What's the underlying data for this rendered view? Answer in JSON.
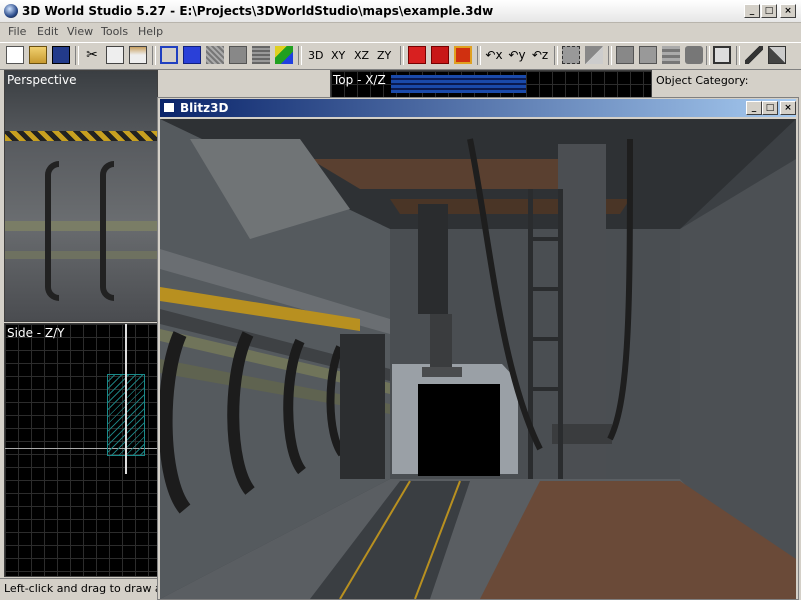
{
  "window": {
    "title": "3D World Studio 5.27 - E:\\Projects\\3DWorldStudio\\maps\\example.3dw",
    "minimize": "_",
    "maximize": "□",
    "close": "×"
  },
  "menu": [
    "File",
    "Edit",
    "View",
    "Tools",
    "Help"
  ],
  "toolbar": {
    "view_buttons": [
      "3D",
      "XY",
      "XZ",
      "ZY"
    ],
    "icons": [
      "new-icon",
      "open-icon",
      "save-icon",
      "cut-icon",
      "copy-icon",
      "paste-icon",
      "wireframe-cube-icon",
      "solid-cube-icon",
      "textured-cube-icon",
      "flat-cube-icon",
      "lightmap-cube-icon",
      "color-cube-icon",
      "red-cube-icon",
      "red-cube-2-icon",
      "red-cube-3-icon",
      "rotate-x-icon",
      "rotate-y-icon",
      "rotate-z-icon",
      "select-icon",
      "vertex-icon",
      "brush-1-icon",
      "brush-2-icon",
      "brush-3-icon",
      "brush-4-icon",
      "entity-icon",
      "eyedropper-icon",
      "paint-icon"
    ]
  },
  "viewports": {
    "perspective": "Perspective",
    "top": "Top - X/Z",
    "side": "Side - Z/Y"
  },
  "right_panel": {
    "label": "Object Category:"
  },
  "status": {
    "text": "Left-click and drag to draw an o"
  },
  "blitz": {
    "title": "Blitz3D"
  }
}
